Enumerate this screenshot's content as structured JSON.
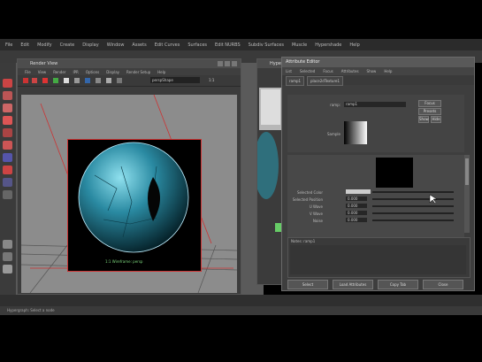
{
  "main_menu": [
    "File",
    "Edit",
    "Modify",
    "Create",
    "Display",
    "Window",
    "Assets",
    "Edit Curves",
    "Surfaces",
    "Edit NURBS",
    "Subdiv Surfaces",
    "Muscle",
    "Hypershade",
    "Help"
  ],
  "help_line": "Hypergraph: Select a node",
  "render_view": {
    "title": "Render View",
    "menu": [
      "File",
      "View",
      "Render",
      "IPR",
      "Options",
      "Display",
      "Render Setup",
      "Help"
    ],
    "camera_select": "perspShape",
    "zoom_value": "1:1",
    "caption": "1:1 Wireframe: persp"
  },
  "hypershade": {
    "title": "Hypershade"
  },
  "attribute_editor": {
    "title": "Attribute Editor",
    "menu": [
      "List",
      "Selected",
      "Focus",
      "Attributes",
      "Show",
      "Help"
    ],
    "tabs": [
      "ramp1",
      "place2dTexture1"
    ],
    "ramp_label": "ramp:",
    "ramp_name": "ramp1",
    "buttons_right": [
      "Focus",
      "Presets",
      "Show",
      "Hide"
    ],
    "sample_label": "Sample",
    "fields": [
      {
        "label": "Selected Color",
        "value": ""
      },
      {
        "label": "Selected Position",
        "value": "0.000"
      },
      {
        "label": "U Wave",
        "value": "0.000"
      },
      {
        "label": "V Wave",
        "value": "0.000"
      },
      {
        "label": "Noise",
        "value": "0.000"
      }
    ],
    "notes_label": "Notes: ramp1",
    "bottom_buttons": [
      "Select",
      "Load Attributes",
      "Copy Tab",
      "Close"
    ]
  },
  "colors": {
    "accent_red": "#c83232",
    "window_bg": "#3e3e3e",
    "caption_green": "#7cd67c"
  }
}
